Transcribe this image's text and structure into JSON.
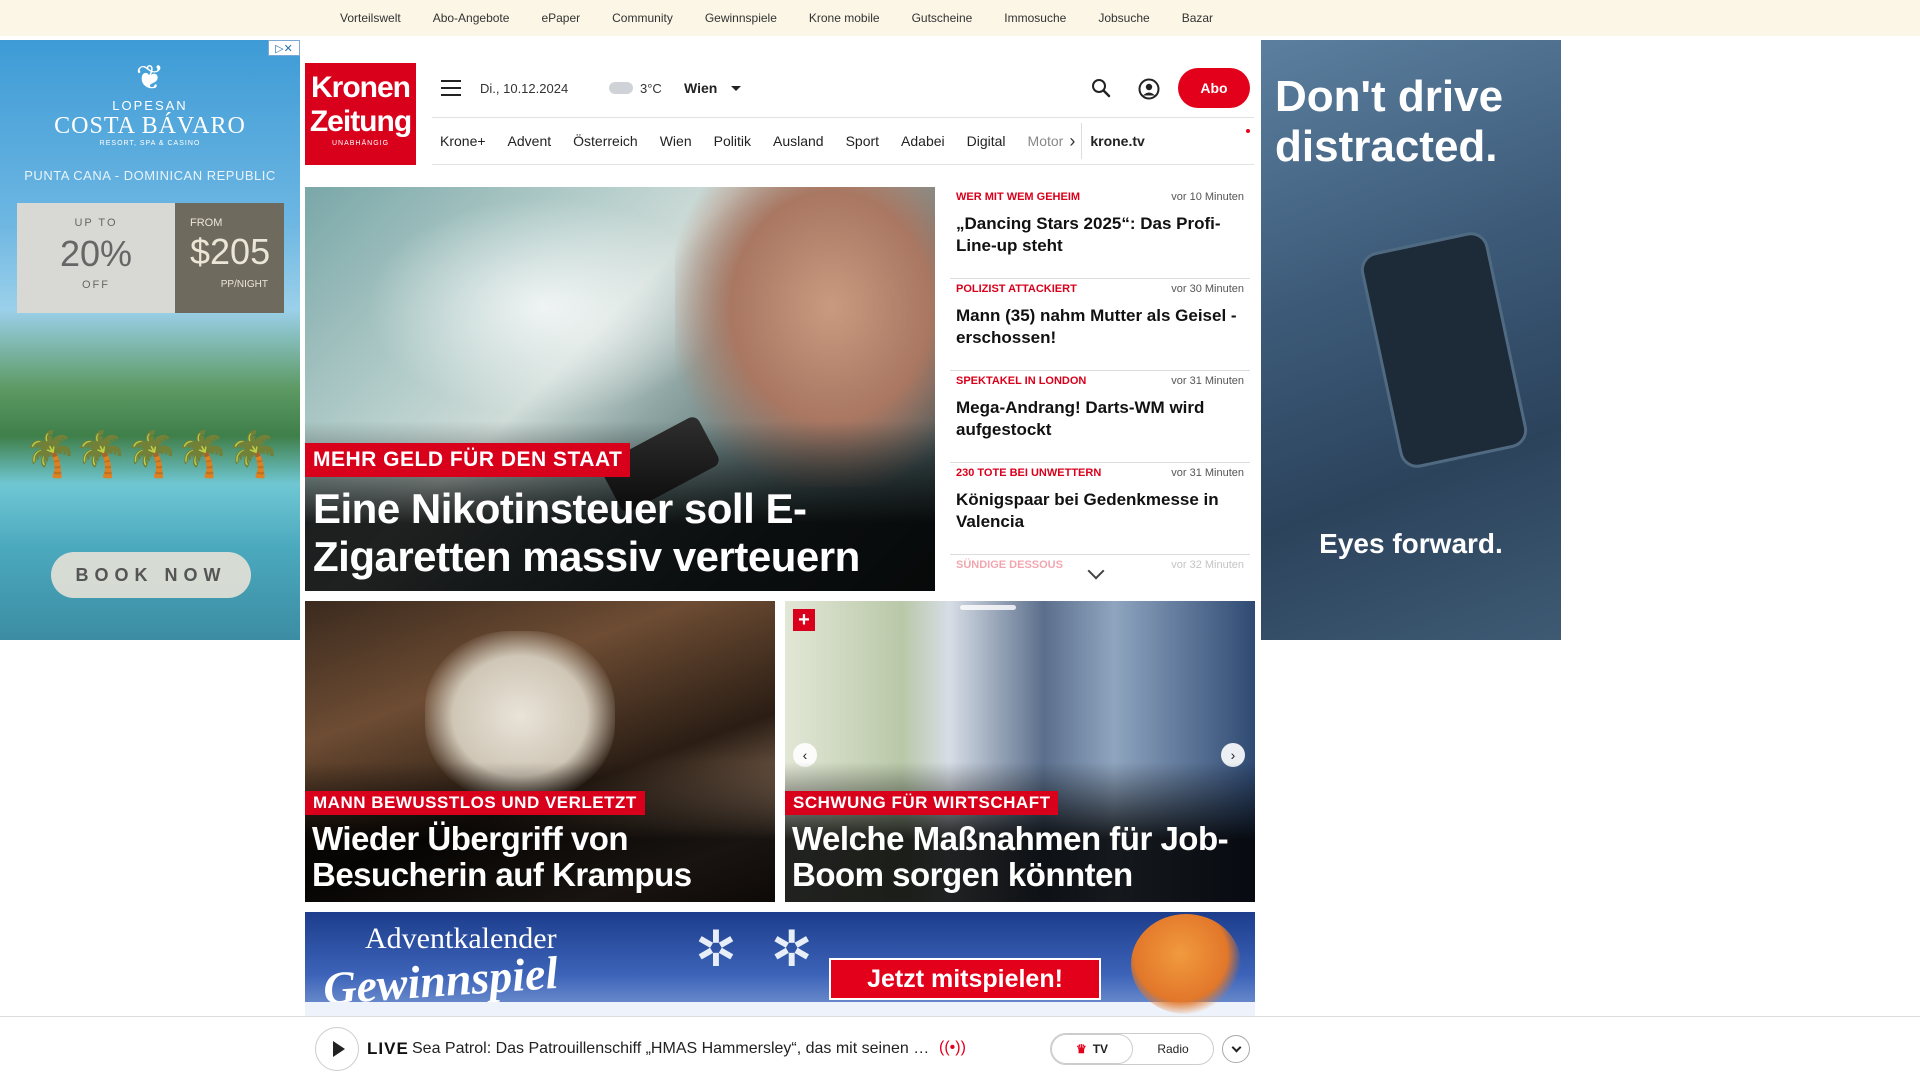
{
  "topnav": [
    "Vorteilswelt",
    "Abo-Angebote",
    "ePaper",
    "Community",
    "Gewinnspiele",
    "Krone mobile",
    "Gutscheine",
    "Immosuche",
    "Jobsuche",
    "Bazar"
  ],
  "ad_left": {
    "adchoices": "▷✕",
    "brand_small": "LOPESAN",
    "brand_main": "COSTA BÁVARO",
    "brand_sub": "RESORT, SPA & CASINO",
    "location": "PUNTA CANA - DOMINICAN REPUBLIC",
    "offer1_top": "UP TO",
    "offer1_value": "20%",
    "offer1_bottom": "OFF",
    "offer2_top": "FROM",
    "offer2_value": "$205",
    "offer2_bottom": "PP/NIGHT",
    "cta": "BOOK NOW"
  },
  "ad_right": {
    "headline": "Don't drive distracted.",
    "tagline": "Eyes forward."
  },
  "header": {
    "logo_line1": "Kronen",
    "logo_line2": "Zeitung",
    "logo_line3": "UNABHÄNGIG",
    "date": "Di., 10.12.2024",
    "temperature": "3°C",
    "city": "Wien",
    "abo_label": "Abo"
  },
  "nav": {
    "items": [
      "Krone+",
      "Advent",
      "Österreich",
      "Wien",
      "Politik",
      "Ausland",
      "Sport",
      "Adabei",
      "Digital"
    ],
    "faded_item": "Motor",
    "tv": "krone.tv"
  },
  "hero": {
    "kicker": "MEHR GELD FÜR DEN STAAT",
    "headline": "Eine Nikotinsteuer soll E-Zigaretten massiv verteuern"
  },
  "ticker": [
    {
      "category": "WER MIT WEM GEHEIM",
      "time": "vor 10 Minuten",
      "title": "„Dancing Stars 2025“: Das Profi-Line-up steht"
    },
    {
      "category": "POLIZIST ATTACKIERT",
      "time": "vor 30 Minuten",
      "title": "Mann (35) nahm Mutter als Geisel - erschossen!"
    },
    {
      "category": "SPEKTAKEL IN LONDON",
      "time": "vor 31 Minuten",
      "title": "Mega-Andrang! Darts-WM wird aufgestockt"
    },
    {
      "category": "230 TOTE BEI UNWETTERN",
      "time": "vor 31 Minuten",
      "title": "Königspaar bei Gedenkmesse in Valencia"
    },
    {
      "category": "SÜNDIGE DESSOUS",
      "time": "vor 32 Minuten",
      "title": ""
    }
  ],
  "teasers": [
    {
      "kicker": "MANN BEWUSSTLOS UND VERLETZT",
      "headline": "Wieder Übergriff von Besucherin auf Krampus"
    },
    {
      "kicker": "SCHWUNG FÜR WIRTSCHAFT",
      "headline": "Welche Maßnahmen für Job-Boom sorgen könnten",
      "badge": "+"
    }
  ],
  "advent": {
    "line1": "Adventkalender",
    "line2": "Gewinnspiel",
    "cta": "Jetzt mitspielen!"
  },
  "player": {
    "live_label": "LIVE",
    "show": "Sea Patrol: Das Patrouillenschiff „HMAS Hammersley“, das mit seinen 2...",
    "tab_tv": "TV",
    "tab_radio": "Radio"
  },
  "colors": {
    "brand_red": "#d9001b",
    "topbar_bg": "#fbf6e6"
  }
}
